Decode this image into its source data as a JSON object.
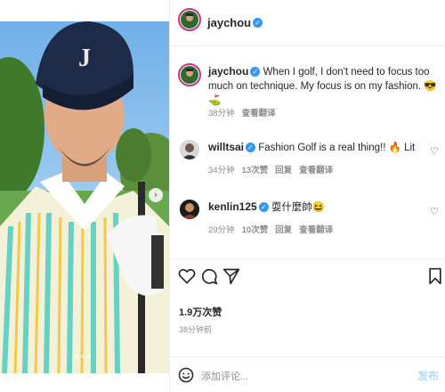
{
  "post": {
    "author": "jaychou",
    "caption": "When I golf, I don't need to focus too much on technique. My focus is on my fashion.",
    "caption_emoji": "😎⛳",
    "time": "38分钟",
    "translate": "查看翻译",
    "likes": "1.9万次赞",
    "posted_ago": "38分钟前"
  },
  "comments": [
    {
      "user": "willtsai",
      "text": "Fashion Golf is a real thing!! 🔥 Lit",
      "time": "34分钟",
      "likes": "13次赞",
      "reply": "回复",
      "translate": "查看翻译"
    },
    {
      "user": "kenlin125",
      "text": "耍什麼帥😆",
      "time": "29分钟",
      "likes": "10次赞",
      "reply": "回复",
      "translate": "查看翻译"
    }
  ],
  "composer": {
    "placeholder": "添加评论...",
    "post_label": "发布"
  },
  "icons": {
    "heart": "heart-icon",
    "comment": "comment-icon",
    "share": "share-icon",
    "save": "bookmark-icon",
    "emoji": "emoji-icon",
    "verified": "verified-badge-icon"
  },
  "colors": {
    "verified": "#3897f0",
    "post_button": "#b3dbff",
    "meta": "#8e8e8e"
  }
}
